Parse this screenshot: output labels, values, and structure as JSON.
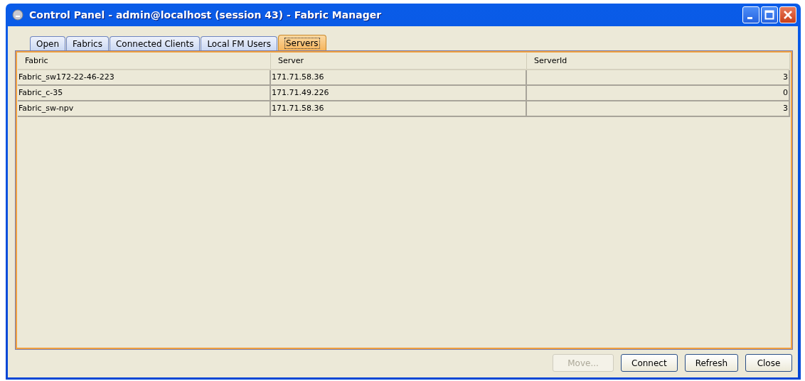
{
  "window": {
    "title": "Control Panel - admin@localhost (session 43) - Fabric Manager"
  },
  "tabs": [
    {
      "label": "Open",
      "selected": false
    },
    {
      "label": "Fabrics",
      "selected": false
    },
    {
      "label": "Connected Clients",
      "selected": false
    },
    {
      "label": "Local FM Users",
      "selected": false
    },
    {
      "label": "Servers",
      "selected": true
    }
  ],
  "table": {
    "columns": [
      "Fabric",
      "Server",
      "ServerId"
    ],
    "rows": [
      [
        "Fabric_sw172-22-46-223",
        "171.71.58.36",
        "3"
      ],
      [
        "Fabric_c-35",
        "171.71.49.226",
        "0"
      ],
      [
        "Fabric_sw-npv",
        "171.71.58.36",
        "3"
      ]
    ]
  },
  "buttons": [
    {
      "label": "Move...",
      "disabled": true
    },
    {
      "label": "Connect",
      "disabled": false
    },
    {
      "label": "Refresh",
      "disabled": false
    },
    {
      "label": "Close",
      "disabled": false
    }
  ]
}
